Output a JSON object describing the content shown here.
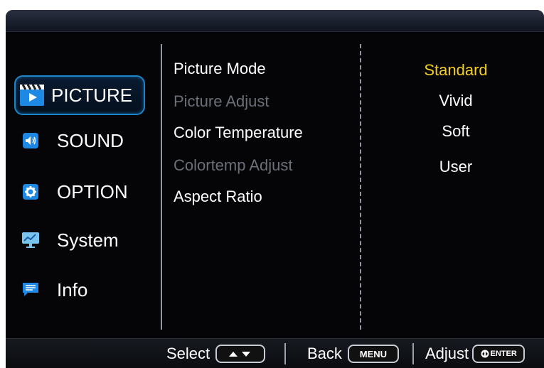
{
  "menu": [
    {
      "label": "PICTURE",
      "icon": "clapperboard-icon",
      "active": true
    },
    {
      "label": "SOUND",
      "icon": "speaker-icon",
      "active": false
    },
    {
      "label": "OPTION",
      "icon": "gear-icon",
      "active": false
    },
    {
      "label": "System",
      "icon": "monitor-chart-icon",
      "active": false
    },
    {
      "label": "Info",
      "icon": "chat-bubble-icon",
      "active": false
    }
  ],
  "options": [
    {
      "label": "Picture Mode",
      "enabled": true
    },
    {
      "label": "Picture Adjust",
      "enabled": false
    },
    {
      "label": "Color Temperature",
      "enabled": true
    },
    {
      "label": "Colortemp Adjust",
      "enabled": false
    },
    {
      "label": "Aspect Ratio",
      "enabled": true
    }
  ],
  "values": [
    {
      "label": "Standard",
      "selected": true
    },
    {
      "label": "Vivid",
      "selected": false
    },
    {
      "label": "Soft",
      "selected": false
    },
    {
      "label": "User",
      "selected": false
    }
  ],
  "bottom": {
    "select_label": "Select",
    "back_label": "Back",
    "back_key": "MENU",
    "adjust_label": "Adjust",
    "adjust_key": "ENTER"
  },
  "colors": {
    "selected_value": "#f5d020",
    "disabled_text": "#6a6f78",
    "active_border": "#1d86c8",
    "icon_blue": "#1e88e5"
  }
}
